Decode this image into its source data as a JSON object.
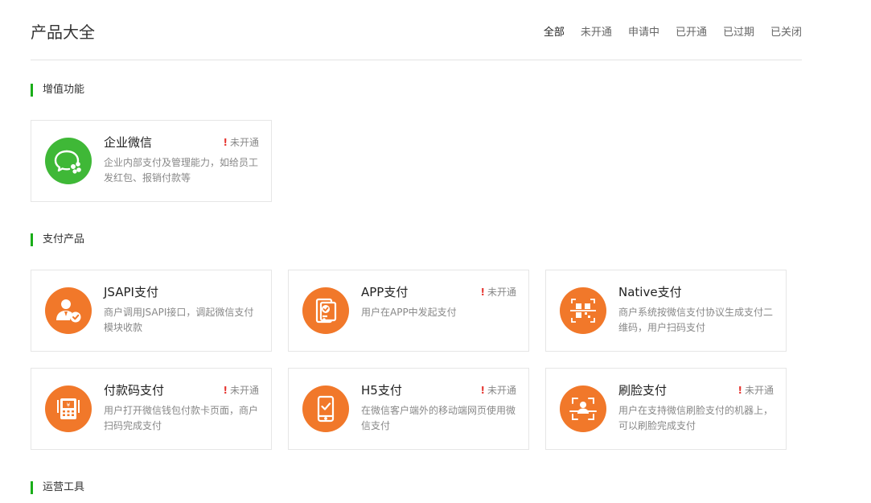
{
  "header": {
    "title": "产品大全",
    "filters": [
      "全部",
      "未开通",
      "申请中",
      "已开通",
      "已过期",
      "已关闭"
    ]
  },
  "colors": {
    "green_accent": "#1aad19",
    "wechat_green": "#3fb837",
    "orange": "#f1782a",
    "status_red": "#e5322d"
  },
  "sections": [
    {
      "title": "增值功能",
      "products": [
        {
          "name": "企业微信",
          "status": "未开通",
          "description": "企业内部支付及管理能力，如给员工发红包、报销付款等",
          "icon": "wechat-work-icon"
        }
      ]
    },
    {
      "title": "支付产品",
      "products": [
        {
          "name": "JSAPI支付",
          "status": "",
          "description": "商户调用JSAPI接口，调起微信支付模块收款",
          "icon": "person-check-icon"
        },
        {
          "name": "APP支付",
          "status": "未开通",
          "description": "用户在APP中发起支付",
          "icon": "mobile-app-icon"
        },
        {
          "name": "Native支付",
          "status": "",
          "description": "商户系统按微信支付协议生成支付二维码，用户扫码支付",
          "icon": "qr-code-icon"
        },
        {
          "name": "付款码支付",
          "status": "未开通",
          "description": "用户打开微信钱包付款卡页面，商户扫码完成支付",
          "icon": "pos-terminal-icon"
        },
        {
          "name": "H5支付",
          "status": "未开通",
          "description": "在微信客户端外的移动端网页使用微信支付",
          "icon": "tablet-check-icon"
        },
        {
          "name": "刷脸支付",
          "status": "未开通",
          "description": "用户在支持微信刷脸支付的机器上，可以刷脸完成支付",
          "icon": "face-scan-icon"
        }
      ]
    },
    {
      "title": "运营工具",
      "products": []
    }
  ]
}
